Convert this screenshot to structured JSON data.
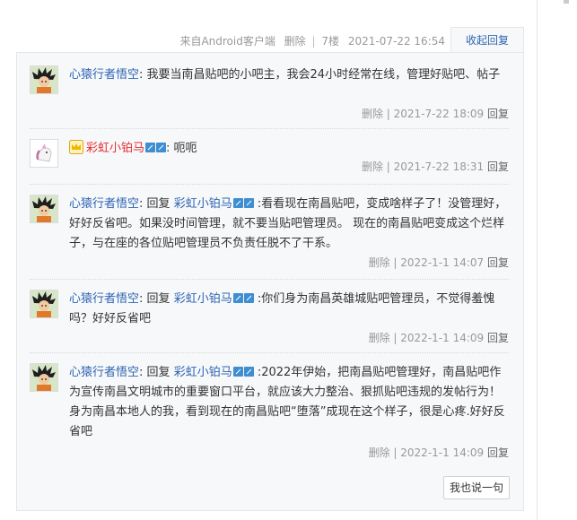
{
  "post_tail": {
    "source": "来自Android客户端",
    "delete": "删除",
    "floor": "7楼",
    "time": "2021-07-22 16:54",
    "toggle_reply": "收起回复"
  },
  "replies": [
    {
      "user": "心猿行者悟空",
      "text": "我要当南昌贴吧的小吧主，我会24小时经常在线，管理好贴吧、帖子",
      "delete": "删除",
      "time": "2021-7-22 18:09",
      "reply": "回复"
    },
    {
      "user": "彩虹小铂马",
      "text": "呃呃",
      "delete": "删除",
      "time": "2021-7-22 18:31",
      "reply": "回复"
    },
    {
      "user": "心猿行者悟空",
      "reply_word": "回复",
      "mention": "彩虹小铂马",
      "text": ":看看现在南昌贴吧，变成啥样子了！没管理好，好好反省吧。如果没时间管理，就不要当贴吧管理员。 现在的南昌贴吧变成这个烂样子，与在座的各位贴吧管理员不负责任脱不了干系。",
      "delete": "删除",
      "time": "2022-1-1 14:07",
      "reply": "回复"
    },
    {
      "user": "心猿行者悟空",
      "reply_word": "回复",
      "mention": "彩虹小铂马",
      "text": ":你们身为南昌英雄城贴吧管理员，不觉得羞愧吗？好好反省吧",
      "delete": "删除",
      "time": "2022-1-1 14:09",
      "reply": "回复"
    },
    {
      "user": "心猿行者悟空",
      "reply_word": "回复",
      "mention": "彩虹小铂马",
      "text": ":2022年伊始，把南昌贴吧管理好，南昌贴吧作为宣传南昌文明城市的重要窗口平台，就应该大力整治、狠抓贴吧违规的发帖行为！身为南昌本地人的我，看到现在的南昌贴吧“堕落”成现在这个样子，很是心疼.好好反省吧",
      "delete": "删除",
      "time": "2022-1-1 14:09",
      "reply": "回复"
    }
  ],
  "say_button": "我也说一句",
  "colors": {
    "link": "#2d64b3",
    "red_name": "#e62e2e",
    "panel_bg": "#f7f8fa"
  }
}
